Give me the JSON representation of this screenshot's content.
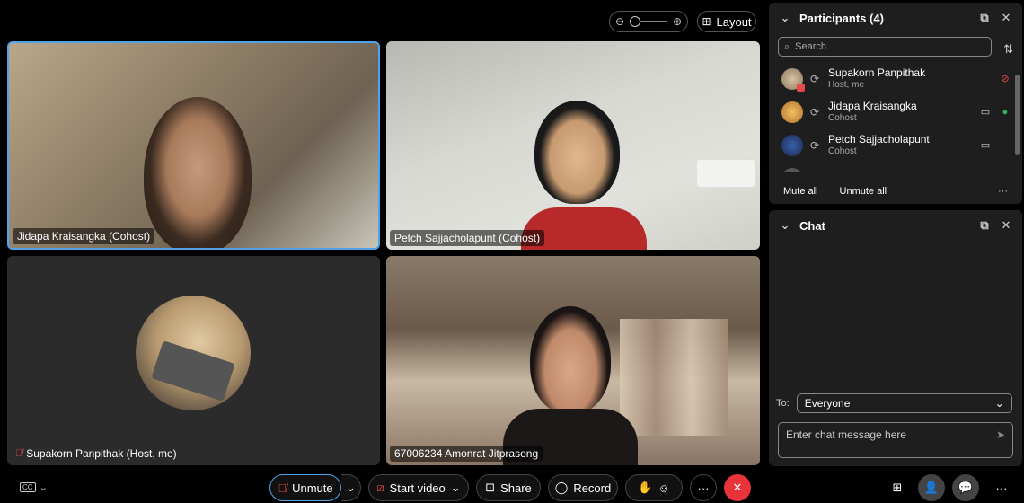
{
  "top_bar": {
    "zoom_out_icon": "zoom-out-icon",
    "zoom_in_icon": "zoom-in-icon",
    "layout_label": "Layout"
  },
  "tiles": {
    "jidapa": "Jidapa Kraisangka (Cohost)",
    "petch": "Petch Sajjacholapunt (Cohost)",
    "supakorn": "Supakorn Panpithak (Host, me)",
    "amonrat": "67006234 Amonrat Jitprasong"
  },
  "participants": {
    "title": "Participants (4)",
    "search_placeholder": "Search",
    "items": [
      {
        "name": "Supakorn Panpithak",
        "role": "Host, me"
      },
      {
        "name": "Jidapa Kraisangka",
        "role": "Cohost"
      },
      {
        "name": "Petch Sajjacholapunt",
        "role": "Cohost"
      }
    ],
    "mute_all": "Mute all",
    "unmute_all": "Unmute all"
  },
  "chat": {
    "title": "Chat",
    "to_label": "To:",
    "to_value": "Everyone",
    "input_placeholder": "Enter chat message here"
  },
  "toolbar": {
    "unmute": "Unmute",
    "start_video": "Start video",
    "share": "Share",
    "record": "Record"
  },
  "colors": {
    "active_border": "#4fa3e8",
    "end_call": "#e8333a",
    "muted_red": "#e5484d",
    "speaking_green": "#2fb56a"
  }
}
